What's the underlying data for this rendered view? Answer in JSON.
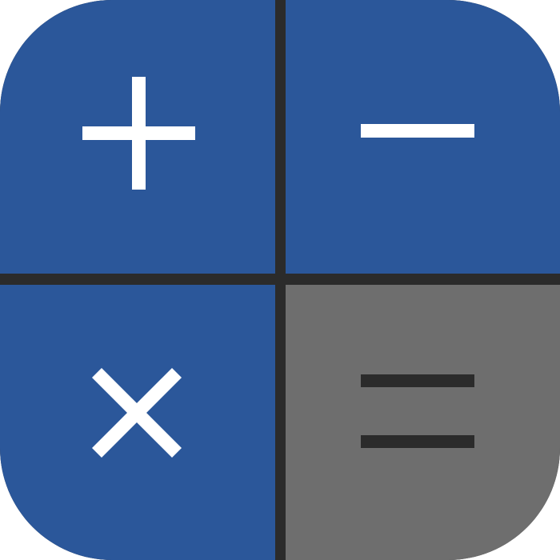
{
  "app_icon": {
    "name": "calculator",
    "colors": {
      "operator_tile": "#2b579a",
      "equals_tile": "#6e6e6e",
      "divider": "#2b2b2b",
      "operator_glyph": "#ffffff",
      "equals_glyph": "#2b2b2b"
    },
    "tiles": [
      {
        "key": "plus-key",
        "icon": "plus-icon"
      },
      {
        "key": "minus-key",
        "icon": "minus-icon"
      },
      {
        "key": "multiply-key",
        "icon": "multiply-icon"
      },
      {
        "key": "equals-key",
        "icon": "equals-icon"
      }
    ]
  }
}
